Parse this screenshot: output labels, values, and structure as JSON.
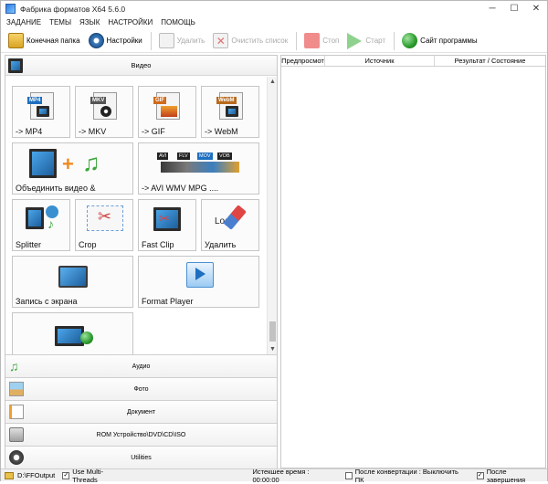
{
  "window": {
    "title": "Фабрика форматов X64 5.6.0",
    "minimize": "─",
    "maximize": "☐",
    "close": "✕"
  },
  "menu": [
    "ЗАДАНИЕ",
    "ТЕМЫ",
    "ЯЗЫК",
    "НАСТРОЙКИ",
    "ПОМОЩЬ"
  ],
  "toolbar": {
    "output_folder": "Конечная папка",
    "settings": "Настройки",
    "delete": "Удалить",
    "clear_list": "Очистить список",
    "stop": "Стоп",
    "start": "Старт",
    "website": "Сайт программы"
  },
  "categories": {
    "video": "Видео",
    "audio": "Аудио",
    "photo": "Фото",
    "document": "Документ",
    "rom": "ROM Устройство\\DVD\\CD\\ISO",
    "utilities": "Utilities"
  },
  "tiles": {
    "mp4": {
      "label": "-> MP4",
      "tag": "MP4"
    },
    "mkv": {
      "label": "-> MKV",
      "tag": "MKV"
    },
    "gif": {
      "label": "-> GIF",
      "tag": "GIF"
    },
    "webm": {
      "label": "-> WebM",
      "tag": "WebM"
    },
    "join": {
      "label": "Объединить видео &"
    },
    "avi": {
      "label": "-> AVI WMV MPG ....",
      "tags": [
        "AVI",
        "FLV",
        "MOV",
        "VOB"
      ]
    },
    "splitter": {
      "label": "Splitter"
    },
    "crop": {
      "label": "Crop"
    },
    "fastclip": {
      "label": "Fast Clip"
    },
    "remove_logo": {
      "label": "Удалить",
      "overlay": "Logo"
    },
    "screen_record": {
      "label": "Запись с экрана"
    },
    "format_player": {
      "label": "Format Player"
    }
  },
  "task_table": {
    "columns": [
      "Предпросмот",
      "Источник",
      "Результат / Состояние"
    ]
  },
  "status": {
    "output_path": "D:\\FFOutput",
    "multithreads": "Use Multi-Threads",
    "elapsed": "Истекшее время : 00:00:00",
    "after_convert": "После конвертации : Выключить ПК",
    "notify": "После завершения"
  },
  "colors": {
    "stop_red": "#f08c8c",
    "start_green": "#8fd28f",
    "accent_blue": "#1e6fbf"
  }
}
